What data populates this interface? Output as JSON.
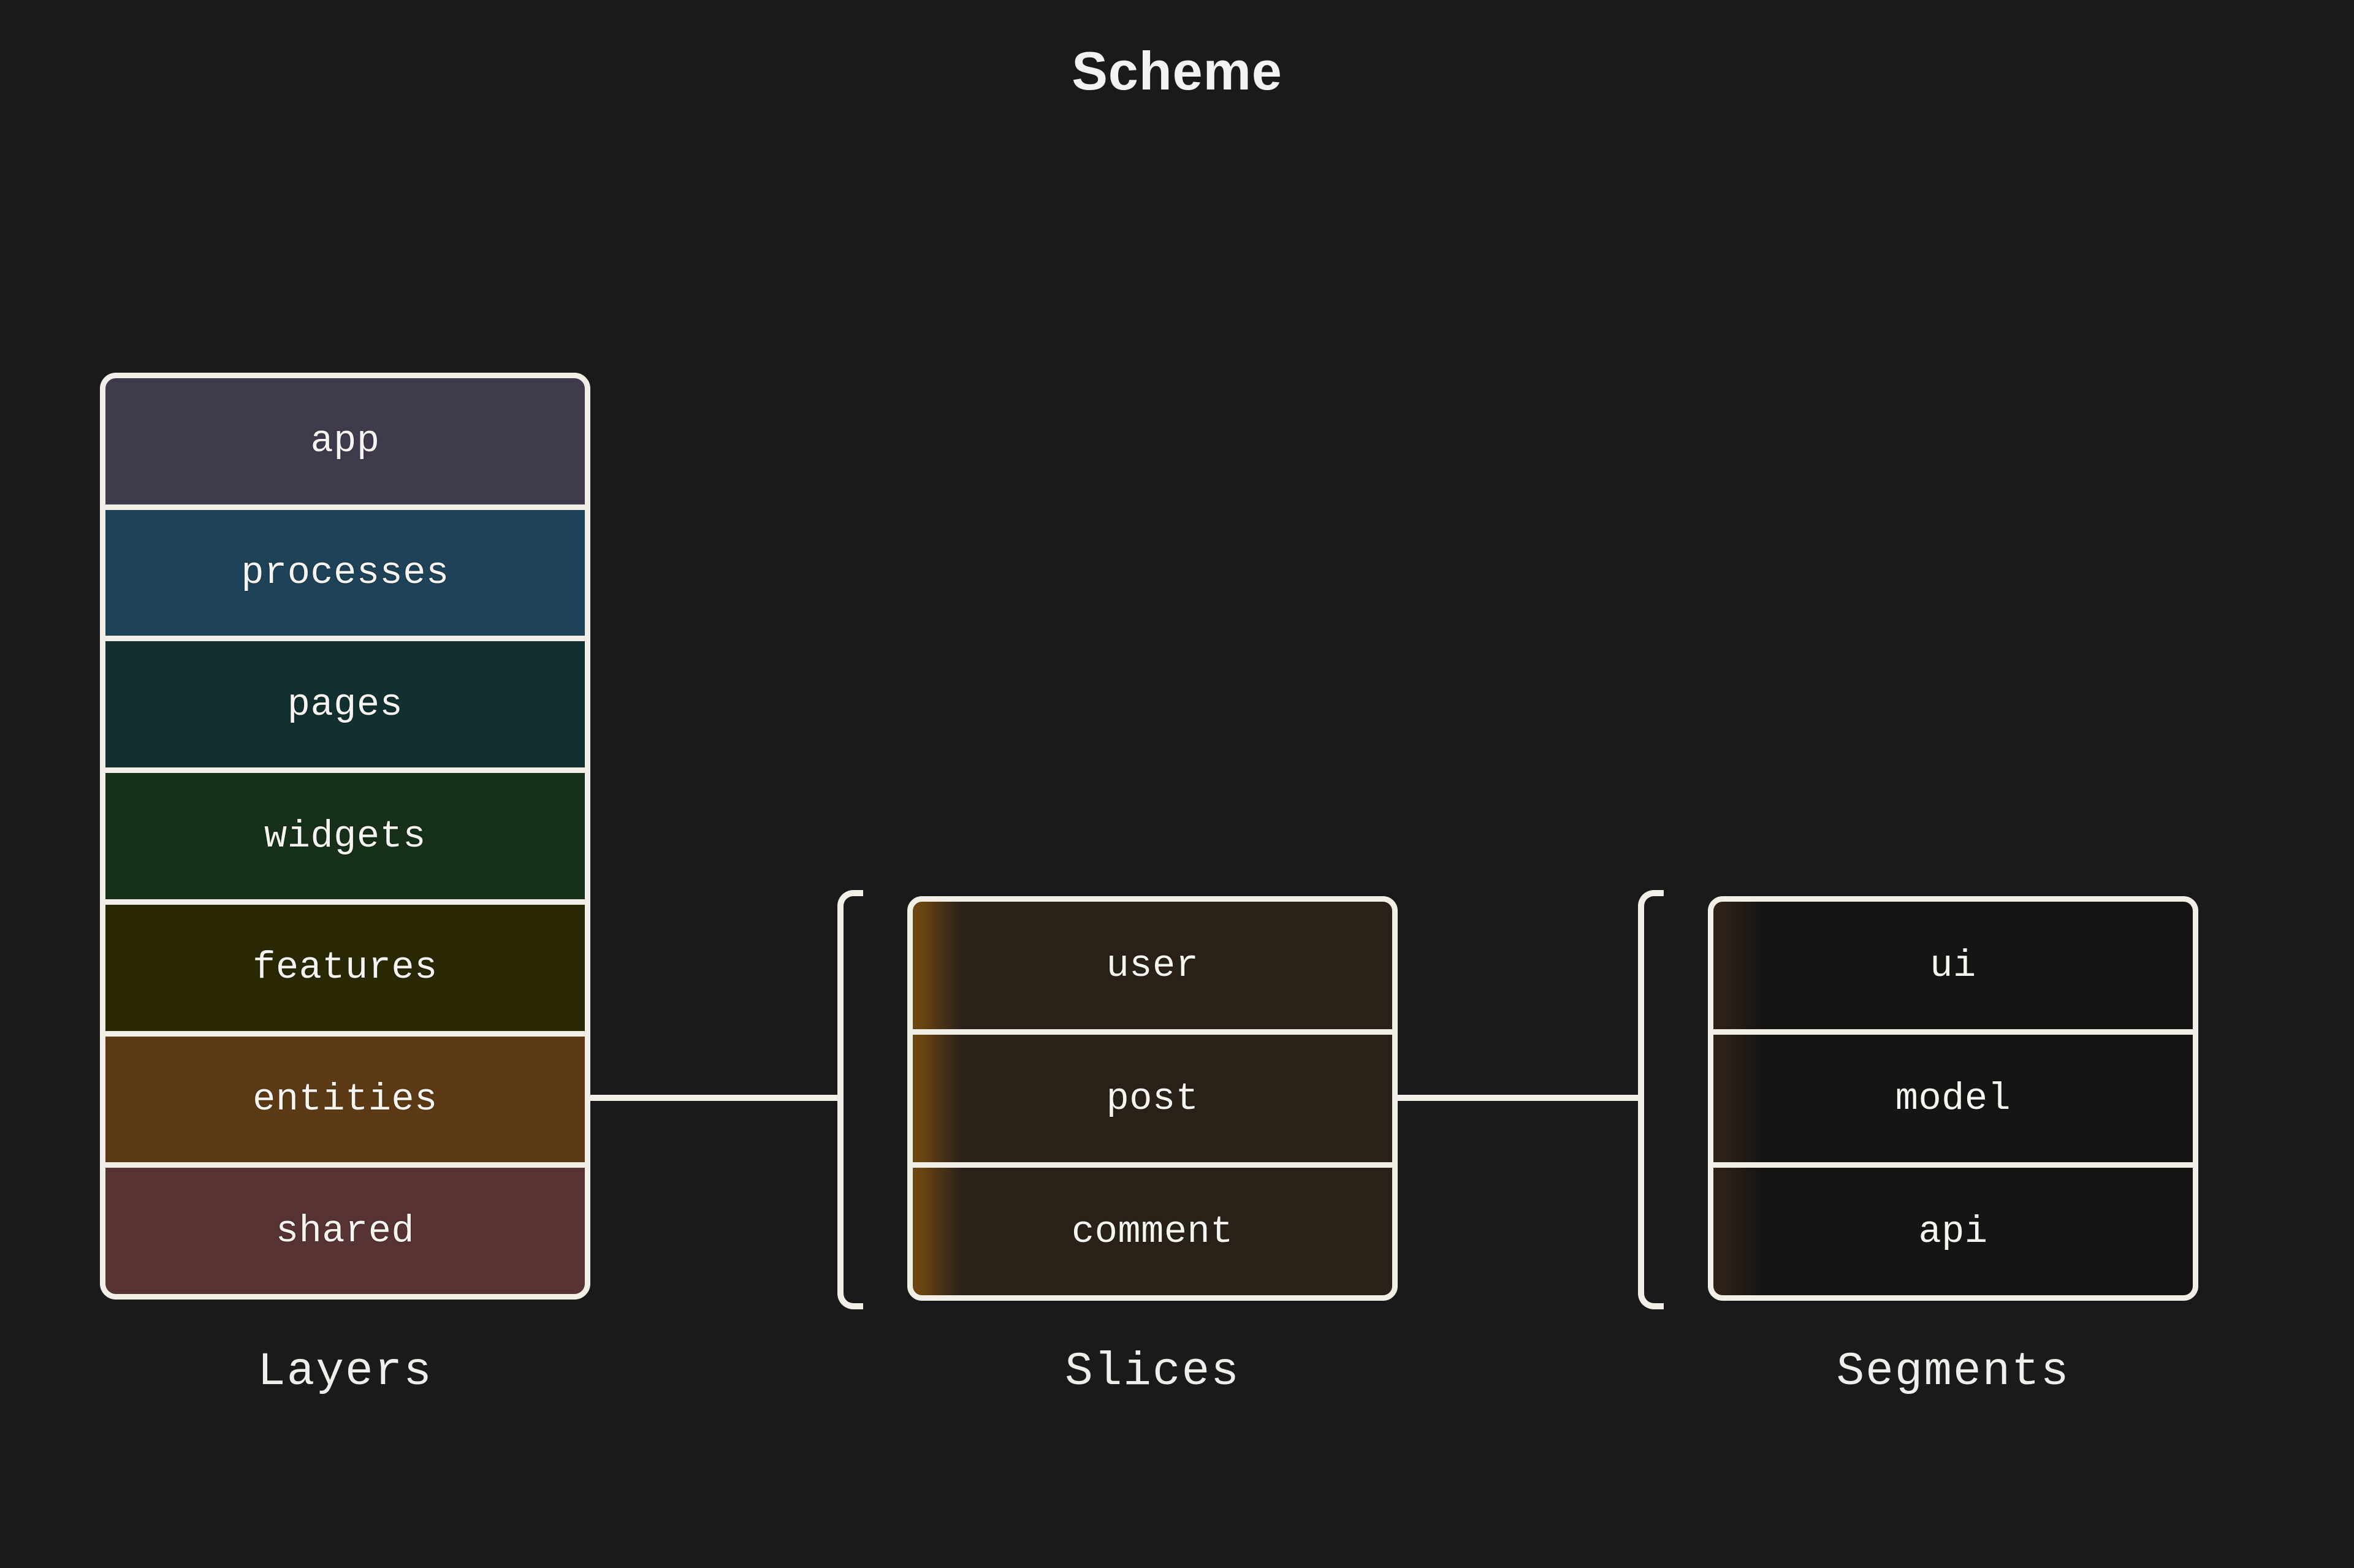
{
  "title": "Scheme",
  "background_color": "#1a1a1a",
  "border_color": "#f2efe9",
  "text_color": "#f6f4f0",
  "columns": {
    "layers": {
      "caption": "Layers",
      "items": [
        {
          "label": "app",
          "color": "#403a4d"
        },
        {
          "label": "processes",
          "color": "#1e4257"
        },
        {
          "label": "pages",
          "color": "#11302f"
        },
        {
          "label": "widgets",
          "color": "#16301a"
        },
        {
          "label": "features",
          "color": "#2b2905"
        },
        {
          "label": "entities",
          "color": "#5c3a16"
        },
        {
          "label": "shared",
          "color": "#573334"
        }
      ]
    },
    "slices": {
      "caption": "Slices",
      "bracket": "[",
      "items": [
        {
          "label": "user",
          "color": "#2a2219",
          "accent": "#6b4512"
        },
        {
          "label": "post",
          "color": "#2a2219",
          "accent": "#6b4512"
        },
        {
          "label": "comment",
          "color": "#2a2219",
          "accent": "#6b4512"
        }
      ]
    },
    "segments": {
      "caption": "Segments",
      "bracket": "[",
      "items": [
        {
          "label": "ui",
          "color": "#161514",
          "accent": "#2e2118"
        },
        {
          "label": "model",
          "color": "#161514",
          "accent": "#2e2118"
        },
        {
          "label": "api",
          "color": "#161514",
          "accent": "#2e2118"
        }
      ]
    }
  },
  "connectors": [
    {
      "from": "layers",
      "to": "slices"
    },
    {
      "from": "slices",
      "to": "segments"
    }
  ]
}
